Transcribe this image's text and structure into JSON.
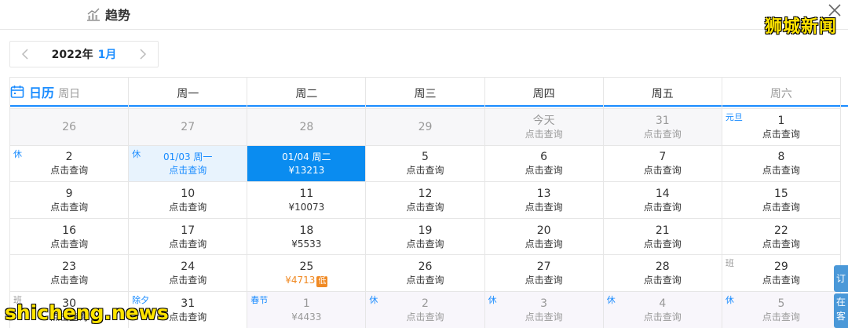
{
  "tabs": [
    {
      "label": "日历",
      "icon": "calendar-icon",
      "active": true
    },
    {
      "label": "趋势",
      "icon": "trend-chart-icon",
      "active": false
    }
  ],
  "watermark_top": "狮城新闻",
  "watermark_bottom": "shicheng.news",
  "nav": {
    "year": "2022年",
    "month": "1月"
  },
  "weekdays": [
    "周日",
    "周一",
    "周二",
    "周三",
    "周四",
    "周五",
    "周六"
  ],
  "weeks": [
    [
      {
        "num": "26",
        "sub": "",
        "state": "out"
      },
      {
        "num": "27",
        "sub": "",
        "state": "out"
      },
      {
        "num": "28",
        "sub": "",
        "state": "out"
      },
      {
        "num": "29",
        "sub": "",
        "state": "out"
      },
      {
        "num": "今天",
        "sub": "点击查询",
        "state": "out"
      },
      {
        "num": "31",
        "sub": "点击查询",
        "state": "out"
      },
      {
        "num": "1",
        "sub": "点击查询",
        "state": "normal",
        "tag": "元旦"
      }
    ],
    [
      {
        "num": "2",
        "sub": "点击查询",
        "state": "normal",
        "tag": "休"
      },
      {
        "num": "01/03 周一",
        "sub": "点击查询",
        "state": "today-sel",
        "tag": "休"
      },
      {
        "num": "01/04 周二",
        "sub": "¥13213",
        "state": "selected"
      },
      {
        "num": "5",
        "sub": "点击查询",
        "state": "normal"
      },
      {
        "num": "6",
        "sub": "点击查询",
        "state": "normal"
      },
      {
        "num": "7",
        "sub": "点击查询",
        "state": "normal"
      },
      {
        "num": "8",
        "sub": "点击查询",
        "state": "normal"
      }
    ],
    [
      {
        "num": "9",
        "sub": "点击查询",
        "state": "normal"
      },
      {
        "num": "10",
        "sub": "点击查询",
        "state": "normal"
      },
      {
        "num": "11",
        "sub": "¥10073",
        "state": "normal"
      },
      {
        "num": "12",
        "sub": "点击查询",
        "state": "normal"
      },
      {
        "num": "13",
        "sub": "点击查询",
        "state": "normal"
      },
      {
        "num": "14",
        "sub": "点击查询",
        "state": "normal"
      },
      {
        "num": "15",
        "sub": "点击查询",
        "state": "normal"
      }
    ],
    [
      {
        "num": "16",
        "sub": "点击查询",
        "state": "normal"
      },
      {
        "num": "17",
        "sub": "点击查询",
        "state": "normal"
      },
      {
        "num": "18",
        "sub": "¥5533",
        "state": "normal"
      },
      {
        "num": "19",
        "sub": "点击查询",
        "state": "normal"
      },
      {
        "num": "20",
        "sub": "点击查询",
        "state": "normal"
      },
      {
        "num": "21",
        "sub": "点击查询",
        "state": "normal"
      },
      {
        "num": "22",
        "sub": "点击查询",
        "state": "normal"
      }
    ],
    [
      {
        "num": "23",
        "sub": "点击查询",
        "state": "normal"
      },
      {
        "num": "24",
        "sub": "点击查询",
        "state": "normal"
      },
      {
        "num": "25",
        "sub": "¥4713",
        "state": "normal",
        "low": "低"
      },
      {
        "num": "26",
        "sub": "点击查询",
        "state": "normal"
      },
      {
        "num": "27",
        "sub": "点击查询",
        "state": "normal"
      },
      {
        "num": "28",
        "sub": "点击查询",
        "state": "normal"
      },
      {
        "num": "29",
        "sub": "点击查询",
        "state": "normal",
        "tag": "班",
        "tagType": "work"
      }
    ],
    [
      {
        "num": "30",
        "sub": "点击查询",
        "state": "normal",
        "tag": "班",
        "tagType": "work"
      },
      {
        "num": "31",
        "sub": "点击查询",
        "state": "normal",
        "tag": "除夕"
      },
      {
        "num": "1",
        "sub": "¥4433",
        "state": "next",
        "tag": "春节"
      },
      {
        "num": "2",
        "sub": "点击查询",
        "state": "next",
        "tag": "休"
      },
      {
        "num": "3",
        "sub": "点击查询",
        "state": "next",
        "tag": "休"
      },
      {
        "num": "4",
        "sub": "点击查询",
        "state": "next",
        "tag": "休"
      },
      {
        "num": "5",
        "sub": "点击查询",
        "state": "next",
        "tag": "休"
      }
    ]
  ],
  "side_buttons": [
    {
      "label": "订"
    },
    {
      "label": "在客"
    }
  ],
  "colors": {
    "accent": "#1a8cff",
    "selected_bg": "#0a8cf0",
    "low_price": "#f08a24"
  }
}
